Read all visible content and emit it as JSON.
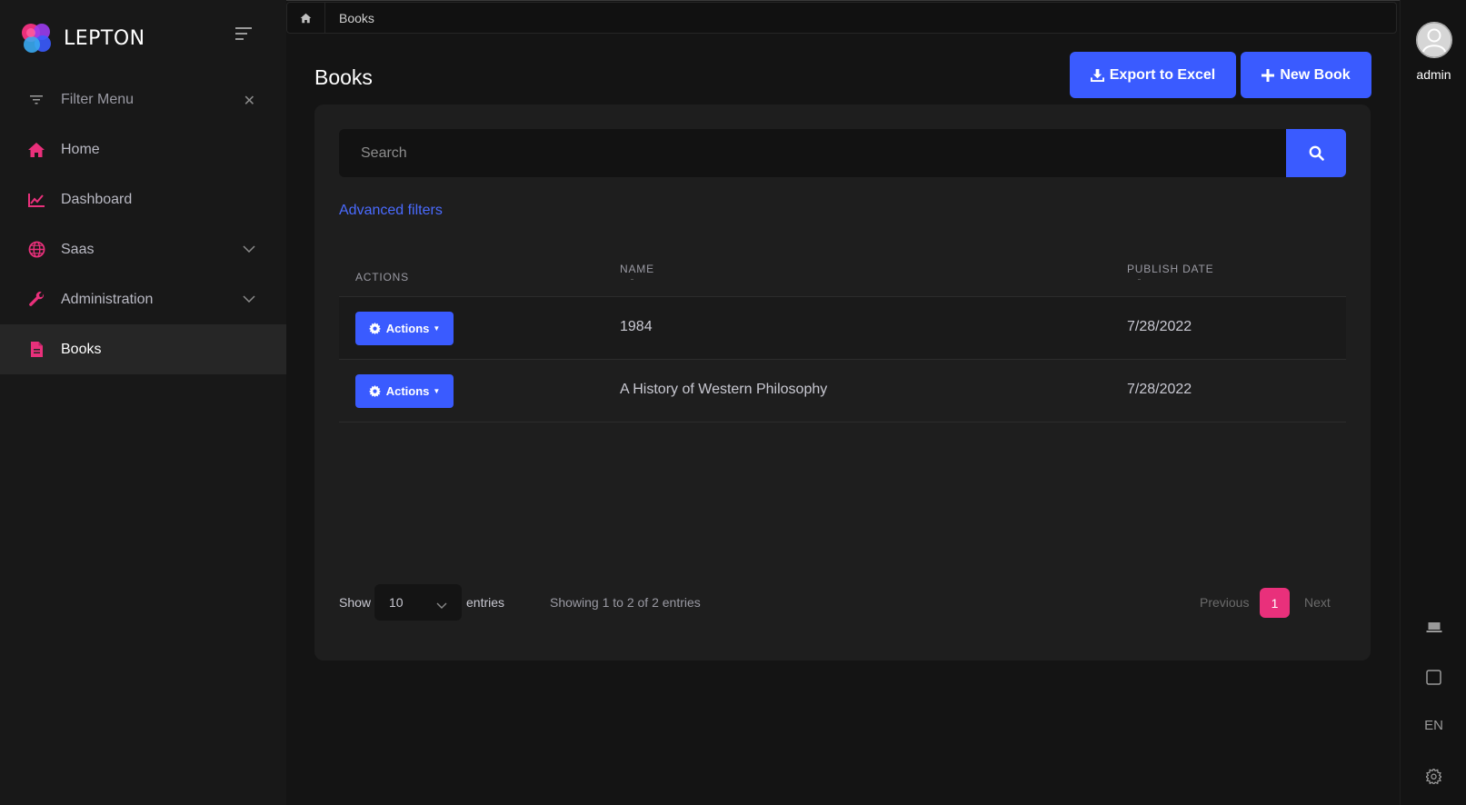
{
  "brand": {
    "name": "LEPTON"
  },
  "sidebar": {
    "filter_label": "Filter Menu",
    "items": [
      {
        "label": "Home",
        "icon": "home-icon"
      },
      {
        "label": "Dashboard",
        "icon": "chart-line-icon"
      },
      {
        "label": "Saas",
        "icon": "globe-icon",
        "expandable": true
      },
      {
        "label": "Administration",
        "icon": "wrench-icon",
        "expandable": true
      },
      {
        "label": "Books",
        "icon": "file-icon",
        "active": true
      }
    ]
  },
  "breadcrumb": {
    "current": "Books"
  },
  "page": {
    "title": "Books",
    "export_label": "Export to Excel",
    "new_label": "New Book"
  },
  "search": {
    "placeholder": "Search"
  },
  "filters": {
    "advanced_label": "Advanced filters"
  },
  "table": {
    "columns": [
      "ACTIONS",
      "NAME",
      "PUBLISH DATE"
    ],
    "action_label": "Actions",
    "rows": [
      {
        "name": "1984",
        "publish_date": "7/28/2022"
      },
      {
        "name": "A History of Western Philosophy",
        "publish_date": "7/28/2022"
      }
    ]
  },
  "pagination": {
    "show_label": "Show",
    "page_size": "10",
    "entries_label": "entries",
    "summary": "Showing 1 to 2 of 2 entries",
    "previous": "Previous",
    "current_page": "1",
    "next": "Next"
  },
  "user": {
    "name": "admin"
  },
  "rail": {
    "language": "EN"
  },
  "colors": {
    "primary": "#3a5bff",
    "accent": "#e9307b",
    "background": "#141414",
    "card": "#1e1e1e"
  }
}
